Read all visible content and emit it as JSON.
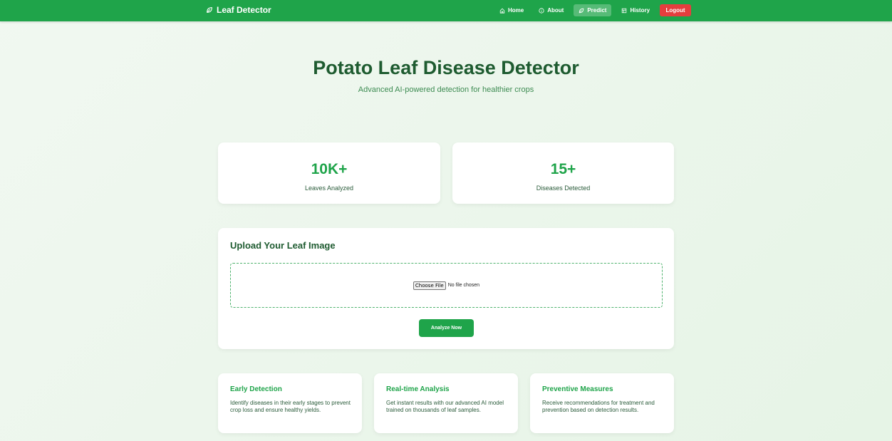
{
  "nav": {
    "brand": "Leaf Detector",
    "items": [
      {
        "label": "Home",
        "icon": "home-icon"
      },
      {
        "label": "About",
        "icon": "info-icon"
      },
      {
        "label": "Predict",
        "icon": "leaf-icon",
        "active": true
      },
      {
        "label": "History",
        "icon": "history-icon"
      }
    ],
    "logout": "Logout"
  },
  "hero": {
    "title": "Potato Leaf Disease Detector",
    "subtitle": "Advanced AI-powered detection for healthier crops"
  },
  "stats": [
    {
      "value": "10K+",
      "label": "Leaves Analyzed"
    },
    {
      "value": "15+",
      "label": "Diseases Detected"
    }
  ],
  "upload": {
    "title": "Upload Your Leaf Image",
    "choose_file": "Choose File",
    "no_file": "No file chosen",
    "analyze": "Analyze Now"
  },
  "features": [
    {
      "title": "Early Detection",
      "text": "Identify diseases in their early stages to prevent crop loss and ensure healthy yields."
    },
    {
      "title": "Real-time Analysis",
      "text": "Get instant results with our advanced AI model trained on thousands of leaf samples."
    },
    {
      "title": "Preventive Measures",
      "text": "Receive recommendations for treatment and prevention based on detection results."
    }
  ],
  "colors": {
    "brand_green": "#1fa44a",
    "dark_green": "#1e5b30",
    "logout_red": "#e53e3e"
  }
}
